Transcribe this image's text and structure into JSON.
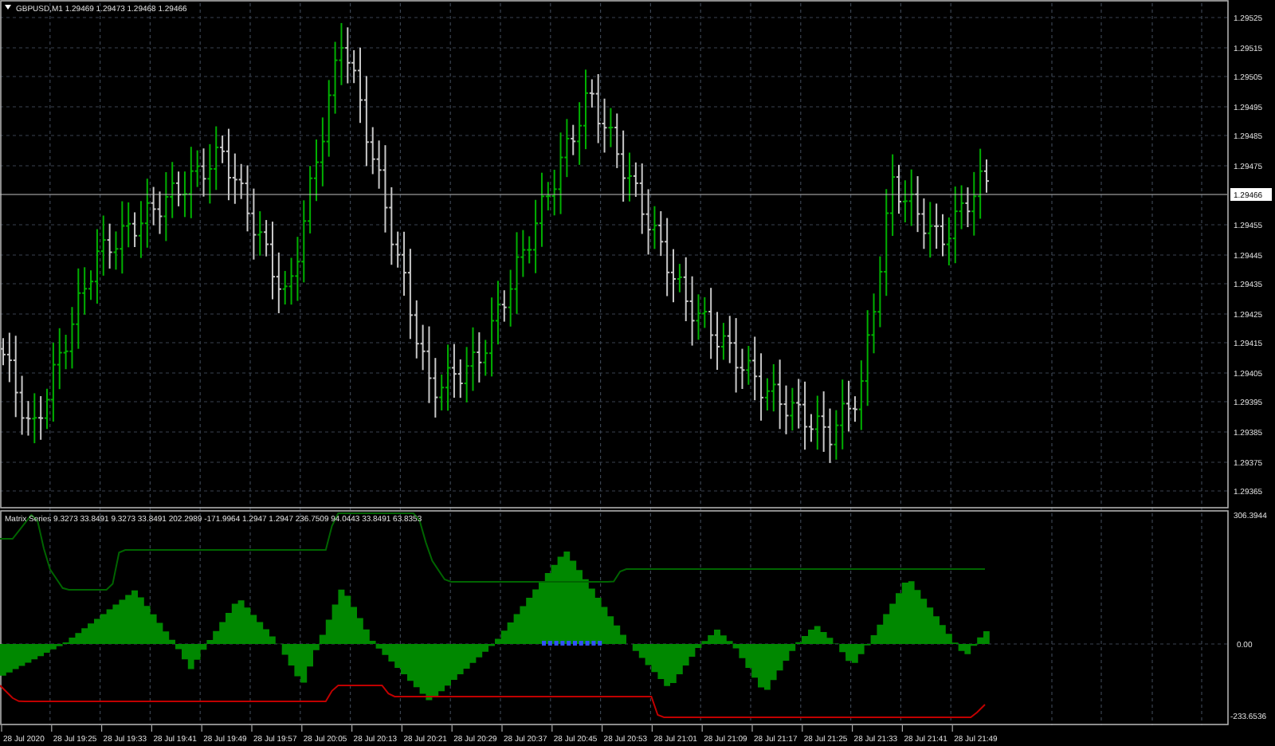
{
  "chart_title": "GBPUSD,M1  1.29469 1.29473 1.29468 1.29466",
  "price_axis": [
    "1.29525",
    "1.29515",
    "1.29505",
    "1.29495",
    "1.29485",
    "1.29475",
    "1.29455",
    "1.29445",
    "1.29435",
    "1.29425",
    "1.29415",
    "1.29405",
    "1.29395",
    "1.29385",
    "1.29375",
    "1.29365"
  ],
  "current_price": "1.29466",
  "indicator": {
    "label": "Matrix Series 9.3273 33.8491 9.3273 33.8491 202.2989 -171.9964 1.2947 1.2947 236.7509 94.0443 33.8491 63.8353",
    "axis": [
      "306.3944",
      "0.00",
      "-233.6536"
    ]
  },
  "time_axis": [
    "28 Jul 2020",
    "28 Jul 19:25",
    "28 Jul 19:33",
    "28 Jul 19:41",
    "28 Jul 19:49",
    "28 Jul 19:57",
    "28 Jul 20:05",
    "28 Jul 20:13",
    "28 Jul 20:21",
    "28 Jul 20:29",
    "28 Jul 20:37",
    "28 Jul 20:45",
    "28 Jul 20:53",
    "28 Jul 21:01",
    "28 Jul 21:09",
    "28 Jul 21:17",
    "28 Jul 21:25",
    "28 Jul 21:33",
    "28 Jul 21:41",
    "28 Jul 21:49"
  ]
}
